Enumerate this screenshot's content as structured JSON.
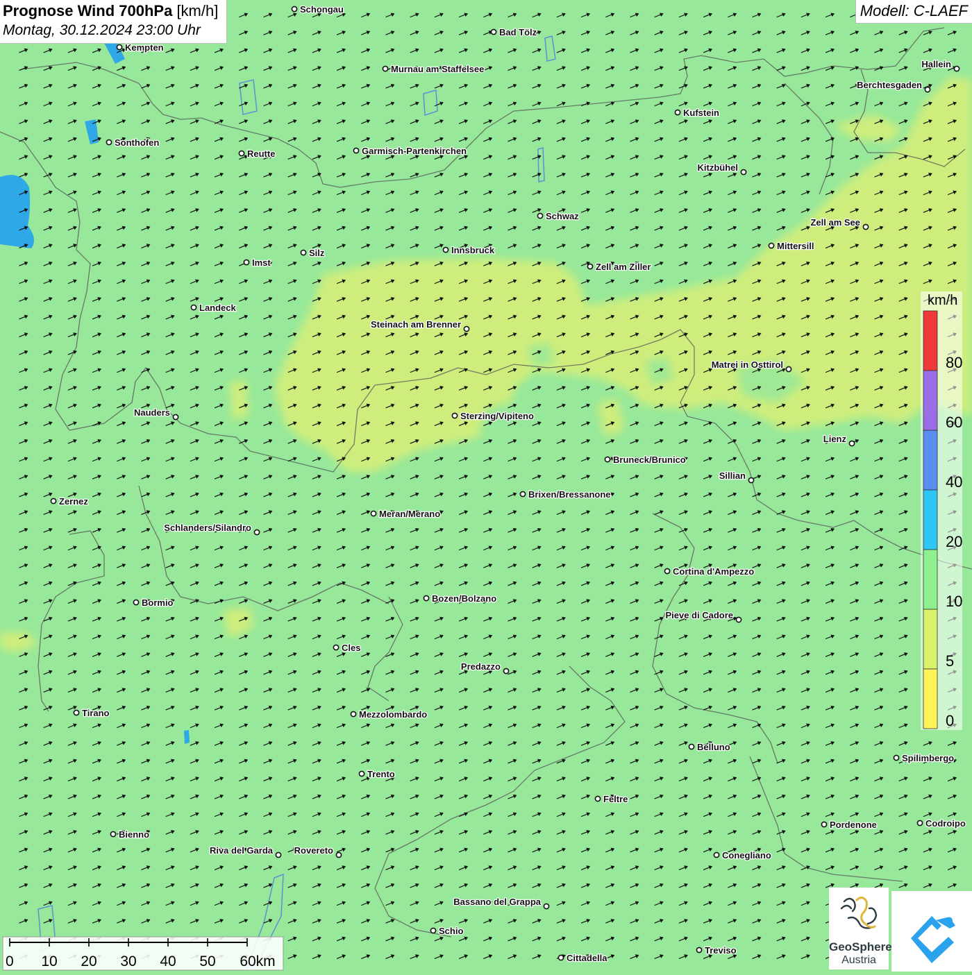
{
  "title": {
    "main": "Prognose Wind 700hPa",
    "unit": "[km/h]",
    "datetime": "Montag, 30.12.2024 23:00 Uhr"
  },
  "model": "Modell: C-LAEF",
  "legend": {
    "unit": "km/h",
    "labels": [
      "80",
      "60",
      "40",
      "20",
      "10",
      "5",
      "0"
    ],
    "colors": [
      "#ee3a3a",
      "#9b6ee8",
      "#5a8ef0",
      "#2ec7f5",
      "#8ff08f",
      "#d8f26a",
      "#fff45a"
    ]
  },
  "scale": {
    "labels": [
      "0",
      "10",
      "20",
      "30",
      "40",
      "50",
      "60km"
    ]
  },
  "logo": {
    "line1": "GeoSphere",
    "line2": "Austria"
  },
  "wind": {
    "dominant_direction": "south-west (arrows pointing north-east)",
    "arrow_icon": "wind-arrow-icon"
  },
  "cities": [
    {
      "name": "Schongau"
    },
    {
      "name": "Bad Tölz"
    },
    {
      "name": "Kempten"
    },
    {
      "name": "Murnau am Staffelsee"
    },
    {
      "name": "Hallein"
    },
    {
      "name": "Berchtesgaden"
    },
    {
      "name": "Kufstein"
    },
    {
      "name": "Sonthofen"
    },
    {
      "name": "Reutte"
    },
    {
      "name": "Garmisch-Partenkirchen"
    },
    {
      "name": "Kitzbühel"
    },
    {
      "name": "Schwaz"
    },
    {
      "name": "Zell am See"
    },
    {
      "name": "Mittersill"
    },
    {
      "name": "Innsbruck"
    },
    {
      "name": "Silz"
    },
    {
      "name": "Imst"
    },
    {
      "name": "Zell am Ziller"
    },
    {
      "name": "Landeck"
    },
    {
      "name": "Steinach am Brenner"
    },
    {
      "name": "Matrei in Osttirol"
    },
    {
      "name": "Nauders"
    },
    {
      "name": "Sterzing/Vipiteno"
    },
    {
      "name": "Lienz"
    },
    {
      "name": "Bruneck/Brunico"
    },
    {
      "name": "Sillian"
    },
    {
      "name": "Brixen/Bressanone"
    },
    {
      "name": "Zernez"
    },
    {
      "name": "Meran/Merano"
    },
    {
      "name": "Schlanders/Silandro"
    },
    {
      "name": "Cortina d'Ampezzo"
    },
    {
      "name": "Bozen/Bolzano"
    },
    {
      "name": "Bormio"
    },
    {
      "name": "Pieve di Cadore"
    },
    {
      "name": "Cles"
    },
    {
      "name": "Predazzo"
    },
    {
      "name": "Tirano"
    },
    {
      "name": "Mezzolombardo"
    },
    {
      "name": "Belluno"
    },
    {
      "name": "Spilimbergo"
    },
    {
      "name": "Trento"
    },
    {
      "name": "Feltre"
    },
    {
      "name": "Pordenone"
    },
    {
      "name": "Codroipo"
    },
    {
      "name": "Bienno"
    },
    {
      "name": "Riva del Garda"
    },
    {
      "name": "Rovereto"
    },
    {
      "name": "Conegliano"
    },
    {
      "name": "Bassano del Grappa"
    },
    {
      "name": "Schio"
    },
    {
      "name": "Treviso"
    },
    {
      "name": "Cittadella"
    }
  ]
}
